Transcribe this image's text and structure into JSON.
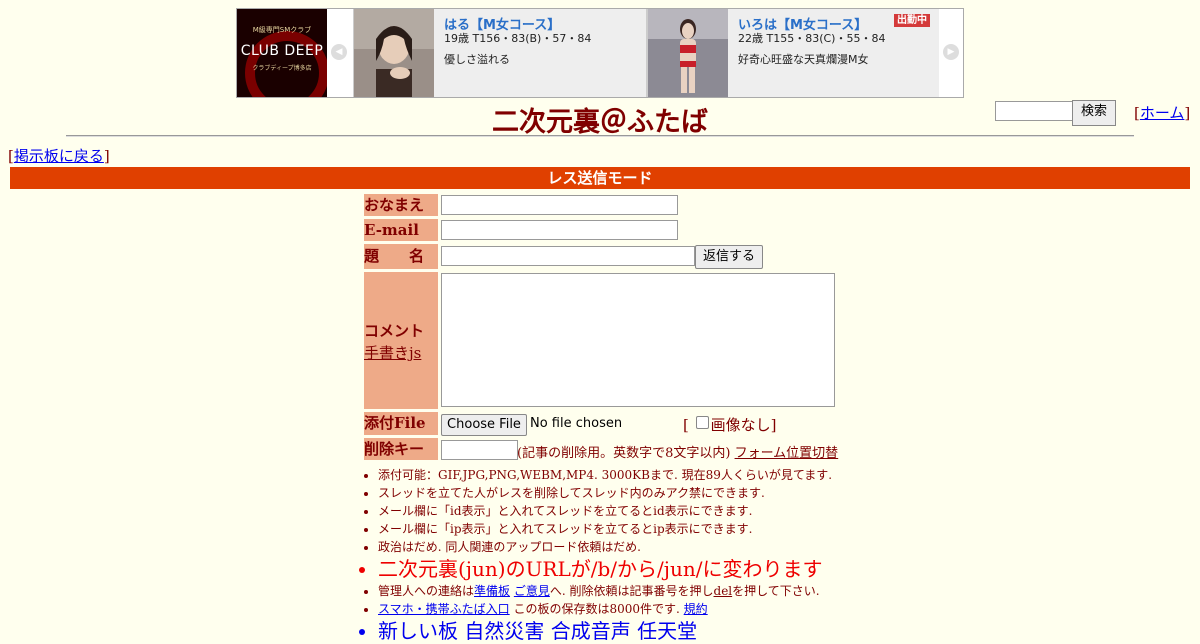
{
  "banner": {
    "logo": {
      "top_text": "M級専門SMクラブ",
      "main_text": "CLUB DEEP",
      "sub_text": "クラブディープ博多店"
    },
    "prev_arrow": "◀",
    "next_arrow": "▶",
    "cards": [
      {
        "name": "はる【M女コース】",
        "spec": "19歳 T156・83(B)・57・84",
        "desc": "優しさ溢れる",
        "badge": ""
      },
      {
        "name": "いろは【M女コース】",
        "spec": "22歳 T155・83(C)・55・84",
        "desc": "好奇心旺盛な天真爛漫M女",
        "badge": "出勤中"
      }
    ]
  },
  "header": {
    "title": "二次元裏＠ふたば",
    "search_button": "検索",
    "home_link": "ホーム",
    "bracket_open": "[",
    "bracket_close": "]"
  },
  "nav": {
    "back_link": "掲示板に戻る"
  },
  "mode_bar": "レス送信モード",
  "form": {
    "name_label": "おなまえ",
    "email_label": "E-mail",
    "subject_label": "題　　名",
    "submit_button": "返信する",
    "comment_label": "コメント",
    "handwriting_link": "手書きjs",
    "file_label": "添付File",
    "choose_file_button": "Choose File",
    "file_status": "No file chosen",
    "no_image_label": "画像なし",
    "delete_key_label": "削除キー",
    "delete_note": "(記事の削除用。英数字で8文字以内)",
    "form_position_link": "フォーム位置切替"
  },
  "notes": {
    "n1": "添付可能：GIF,JPG,PNG,WEBM,MP4. 3000KBまで. 現在89人くらいが見てます.",
    "n2": "スレッドを立てた人がレスを削除してスレッド内のみアク禁にできます.",
    "n3": "メール欄に「id表示」と入れてスレッドを立てるとid表示にできます.",
    "n4": "メール欄に「ip表示」と入れてスレッドを立てるとip表示にできます.",
    "n5": "政治はだめ. 同人関連のアップロード依頼はだめ.",
    "n6": "二次元裏(jun)のURLが/b/から/jun/に変わります",
    "n7_pre": "管理人への連絡は",
    "n7_link1": "準備板",
    "n7_link2": "ご意見",
    "n7_mid": "へ. 削除依頼は記事番号を押し",
    "n7_del": "del",
    "n7_post": "を押して下さい.",
    "n8_link1": "スマホ・携帯ふたば入口",
    "n8_mid": "この板の保存数は8000件です.",
    "n8_link2": "規約",
    "n9": "新しい板  自然災害  合成音声  任天堂"
  }
}
